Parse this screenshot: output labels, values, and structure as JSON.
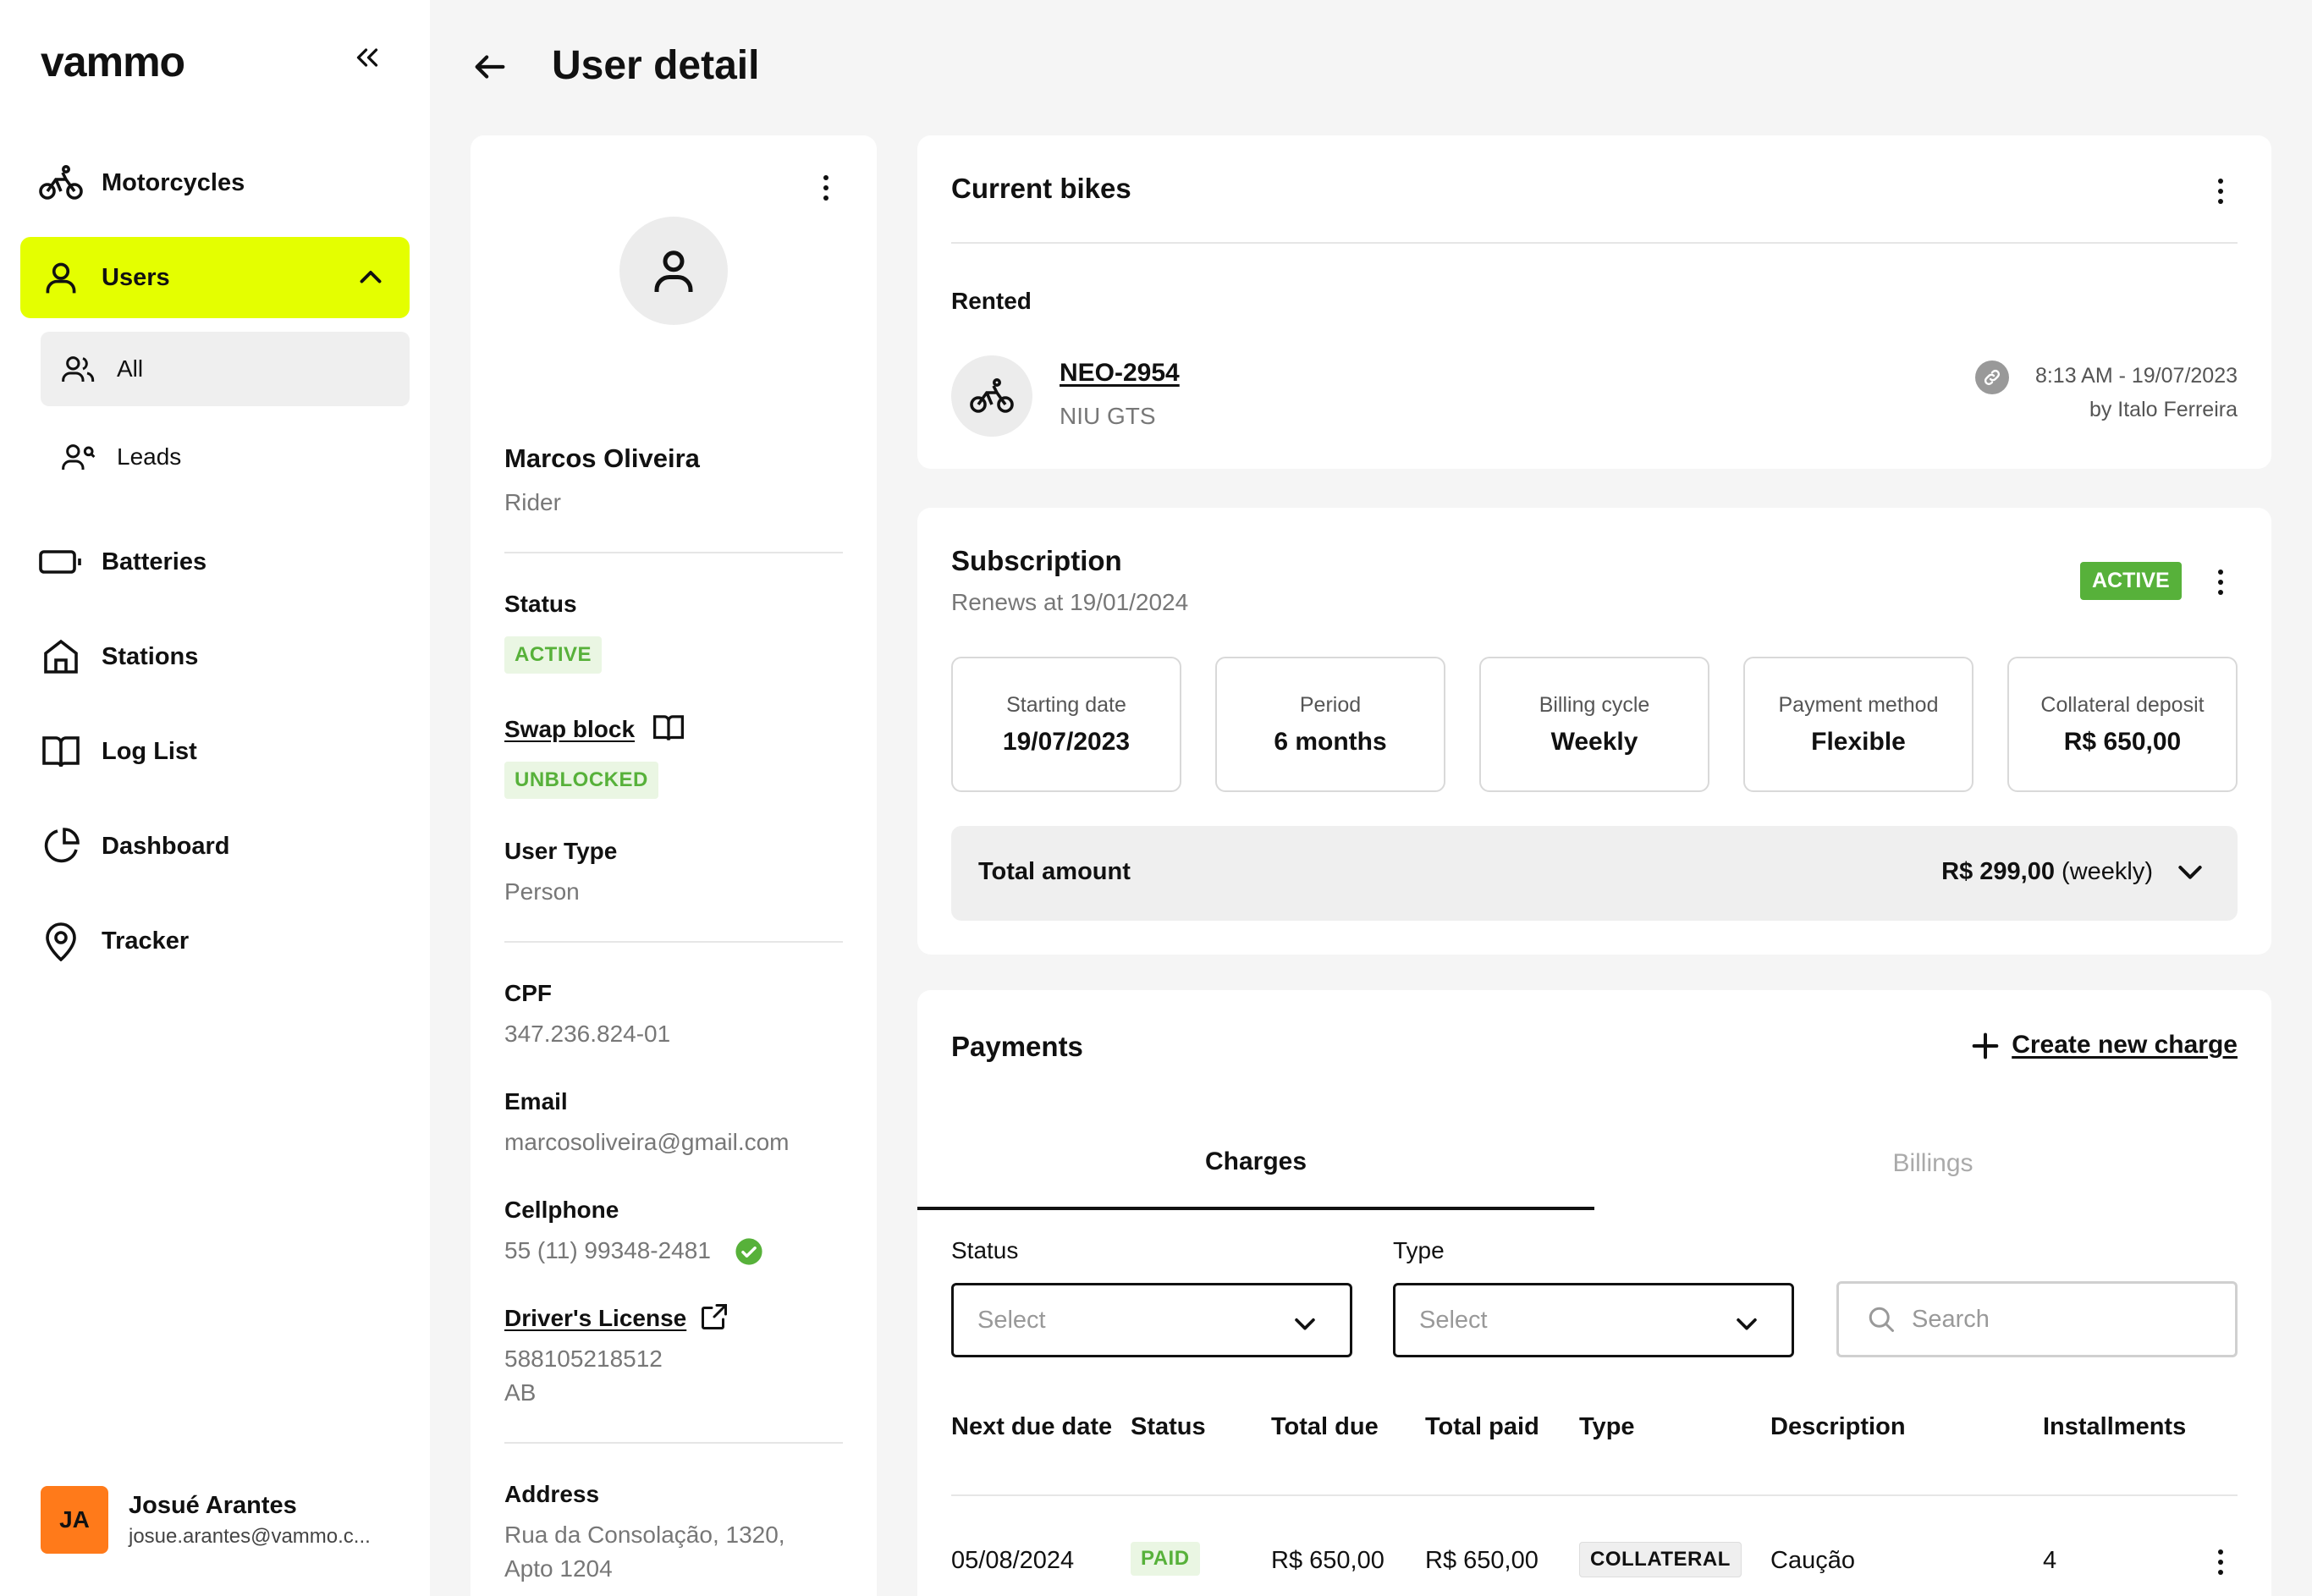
{
  "sidebar": {
    "logo": "vammo",
    "items": [
      {
        "label": "Motorcycles"
      },
      {
        "label": "Users"
      },
      {
        "label": "Batteries"
      },
      {
        "label": "Stations"
      },
      {
        "label": "Log List"
      },
      {
        "label": "Dashboard"
      },
      {
        "label": "Tracker"
      }
    ],
    "sub_items": [
      {
        "label": "All"
      },
      {
        "label": "Leads"
      }
    ],
    "current_user": {
      "initials": "JA",
      "name": "Josué Arantes",
      "email": "josue.arantes@vammo.c..."
    }
  },
  "header": {
    "title": "User detail"
  },
  "profile": {
    "name": "Marcos Oliveira",
    "role": "Rider",
    "status_label": "Status",
    "status_value": "ACTIVE",
    "swap_block_label": "Swap block",
    "swap_block_value": "UNBLOCKED",
    "user_type_label": "User Type",
    "user_type_value": "Person",
    "cpf_label": "CPF",
    "cpf_value": "347.236.824-01",
    "email_label": "Email",
    "email_value": "marcosoliveira@gmail.com",
    "cellphone_label": "Cellphone",
    "cellphone_value": "55 (11) 99348-2481",
    "license_label": "Driver's License",
    "license_number": "588105218512",
    "license_category": "AB",
    "address_label": "Address",
    "address_line1": "Rua da Consolação, 1320,",
    "address_line2": "Apto 1204"
  },
  "current_bikes": {
    "title": "Current bikes",
    "section": "Rented",
    "plate": "NEO-2954",
    "model": "NIU GTS",
    "timestamp": "8:13 AM - 19/07/2023",
    "by": "by Italo Ferreira"
  },
  "subscription": {
    "title": "Subscription",
    "renews": "Renews at 19/01/2024",
    "status": "ACTIVE",
    "tiles": [
      {
        "label": "Starting date",
        "value": "19/07/2023"
      },
      {
        "label": "Period",
        "value": "6 months"
      },
      {
        "label": "Billing cycle",
        "value": "Weekly"
      },
      {
        "label": "Payment method",
        "value": "Flexible"
      },
      {
        "label": "Collateral deposit",
        "value": "R$ 650,00"
      }
    ],
    "total_label": "Total amount",
    "total_value": "R$ 299,00",
    "total_period": "(weekly)"
  },
  "payments": {
    "title": "Payments",
    "create_label": "Create new charge",
    "tabs": [
      {
        "label": "Charges"
      },
      {
        "label": "Billings"
      }
    ],
    "filters": {
      "status_label": "Status",
      "type_label": "Type",
      "status_placeholder": "Select",
      "type_placeholder": "Select",
      "search_placeholder": "Search"
    },
    "columns": [
      "Next due date",
      "Status",
      "Total due",
      "Total paid",
      "Type",
      "Description",
      "Installments"
    ],
    "rows": [
      {
        "due": "05/08/2024",
        "status": "PAID",
        "total_due": "R$ 650,00",
        "total_paid": "R$ 650,00",
        "type": "COLLATERAL",
        "description": "Caução",
        "installments": "4"
      }
    ]
  },
  "colors": {
    "accent": "#e4ff00",
    "success": "#57b13a",
    "avatar": "#ff7a1a"
  }
}
